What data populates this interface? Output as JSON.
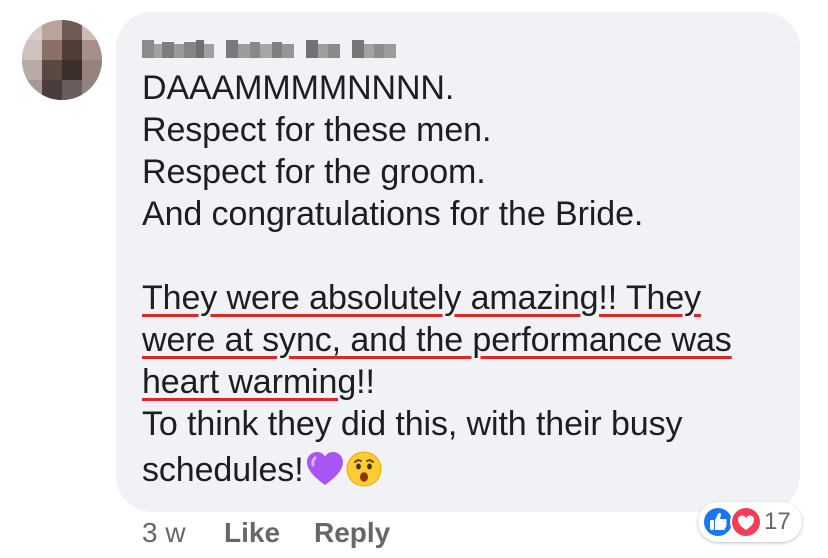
{
  "comment": {
    "author_name": "Francis Denise Bee Jean",
    "lines": [
      "DAAAMMMMNNNN.",
      "Respect for these men.",
      "Respect for the groom.",
      "And congratulations for the Bride.",
      "They were absolutely amazing!! They",
      "were at sync, and the performance was",
      "heart warming",
      "!!",
      "To think they did this, with their busy",
      "schedules!"
    ],
    "emojis": [
      "purple-heart-icon",
      "astonished-face-icon"
    ]
  },
  "footer": {
    "timestamp": "3 w",
    "like_label": "Like",
    "reply_label": "Reply"
  },
  "reactions": {
    "types": [
      "like-reaction-icon",
      "love-reaction-icon"
    ],
    "count": "17"
  },
  "colors": {
    "bubble": "#f0f2f5",
    "text": "#1c1e21",
    "meta": "#65676b",
    "underline": "#e02525",
    "like_blue": "#1877f2",
    "love_red": "#f33e58",
    "purple_heart": "#a855f7"
  }
}
